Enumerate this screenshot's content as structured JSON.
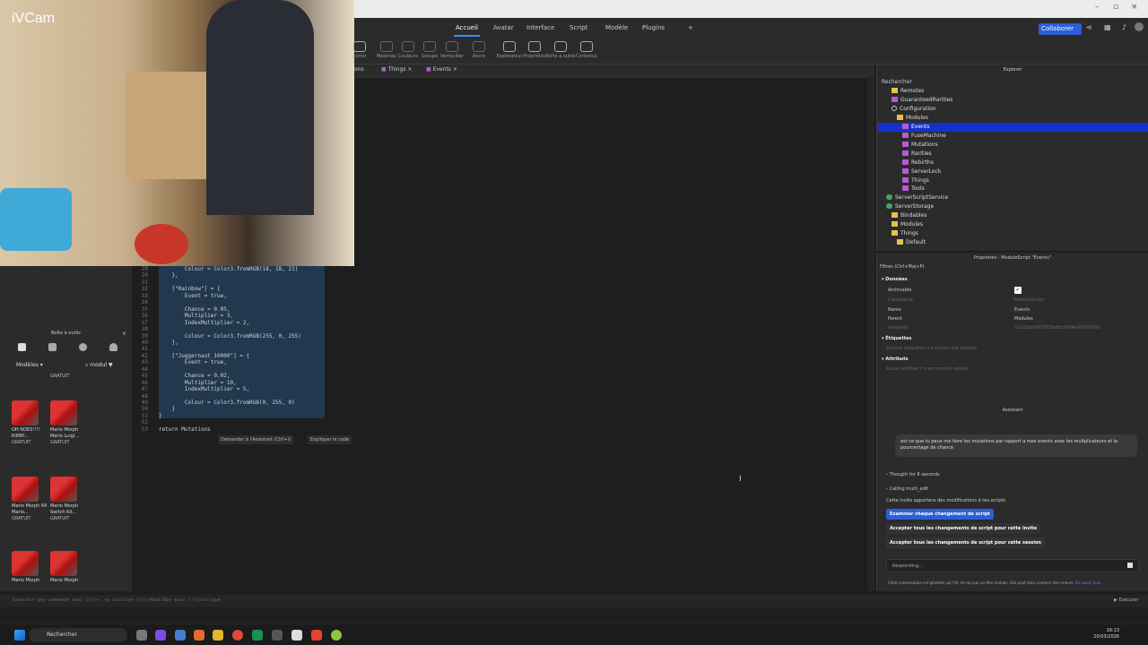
{
  "webcam": {
    "label": "iVCam"
  },
  "ribbon": {
    "tabs": [
      "Accueil",
      "Avatar",
      "Interface",
      "Script",
      "Modèle",
      "Plugins",
      "+"
    ],
    "active_tab": "Accueil",
    "collaborate": "Collaborer",
    "tools": [
      "porter",
      "Matériau",
      "Couleurs",
      "Groupe",
      "Verrouiller",
      "Ancre",
      "Explorateur",
      "Propriétés",
      "Boîte à outils",
      "Contenus"
    ]
  },
  "doc_tabs": [
    "ons",
    "Things",
    "Events"
  ],
  "toolbox": {
    "title": "Boîte à outils",
    "filter": "Modèles",
    "search": "modul",
    "assets": [
      {
        "name": "GRATUIT",
        "price": ""
      },
      {
        "name": "OH NOES!!!! KIRBY...",
        "price": "GRATUIT"
      },
      {
        "name": "Mario Morph Mario Luigi...",
        "price": "GRATUIT"
      },
      {
        "name": "Mario Morph 64 Mario...",
        "price": "GRATUIT"
      },
      {
        "name": "Mario Morph Switch Kit...",
        "price": "GRATUIT"
      },
      {
        "name": "Mario Morph",
        "price": ""
      },
      {
        "name": "Mario Morph",
        "price": ""
      }
    ]
  },
  "code": {
    "line_numbers": [
      "29",
      "30",
      "31",
      "32",
      "33",
      "34",
      "35",
      "36",
      "37",
      "38",
      "39",
      "40",
      "41",
      "42",
      "43",
      "44",
      "45",
      "46",
      "47",
      "48",
      "49",
      "50",
      "51",
      "52",
      "53"
    ],
    "lines": [
      "        Colour = Color3.fromRGB(18, 18, 21)",
      "    },",
      "",
      "    [\"Rainbow\"] = {",
      "        Event = true,",
      "",
      "        Chance = 0.05,",
      "        Multiplier = 3,",
      "        IndexMultiplier = 2,",
      "",
      "        Colour = Color3.fromRGB(255, 0, 255)",
      "    },",
      "",
      "    [\"Juggernaut 10000\"] = {",
      "        Event = true,",
      "",
      "        Chance = 0.02,",
      "        Multiplier = 10,",
      "        IndexMultiplier = 5,",
      "",
      "        Colour = Color3.fromRGB(0, 255, 0)",
      "    }",
      "}",
      "",
      "return Mutations"
    ],
    "ask_assistant": "Demander à l'Assistant (Ctrl+I)",
    "explain_code": "Expliquer le code"
  },
  "command_bar": {
    "placeholder": "Exécuter une commande avec Ctrl+; ou utiliser Ctrl+Haut/Bas pour l'historique",
    "run": "Exécuter"
  },
  "explorer": {
    "title": "Explorer",
    "search": "Rechercher",
    "tree": [
      {
        "label": "Remotes",
        "type": "folder",
        "indent": 1
      },
      {
        "label": "GuaranteedRarities",
        "type": "module",
        "indent": 1
      },
      {
        "label": "Configuration",
        "type": "gear",
        "indent": 1
      },
      {
        "label": "Modules",
        "type": "folder",
        "indent": 2
      },
      {
        "label": "Events",
        "type": "module",
        "indent": 3,
        "selected": true
      },
      {
        "label": "FuseMachine",
        "type": "module",
        "indent": 3
      },
      {
        "label": "Mutations",
        "type": "module",
        "indent": 3
      },
      {
        "label": "Rarities",
        "type": "module",
        "indent": 3
      },
      {
        "label": "Rebirths",
        "type": "module",
        "indent": 3
      },
      {
        "label": "ServerLock",
        "type": "module",
        "indent": 3
      },
      {
        "label": "Things",
        "type": "module",
        "indent": 3
      },
      {
        "label": "Tools",
        "type": "module",
        "indent": 3
      },
      {
        "label": "ServerScriptService",
        "type": "service",
        "indent": 0
      },
      {
        "label": "ServerStorage",
        "type": "service",
        "indent": 0
      },
      {
        "label": "Bindables",
        "type": "folder",
        "indent": 1
      },
      {
        "label": "Modules",
        "type": "folder",
        "indent": 1
      },
      {
        "label": "Things",
        "type": "folder",
        "indent": 1
      },
      {
        "label": "Default",
        "type": "folder",
        "indent": 2
      }
    ]
  },
  "properties": {
    "title": "Propriétés - ModuleScript \"Events\"",
    "filter": "Filtres (Ctrl+Maj+P)",
    "section_data": "Données",
    "archivable": "Archivable",
    "classname": "ClassName",
    "classname_value": "ModuleScript",
    "name_label": "Name",
    "name_value": "Events",
    "parent_label": "Parent",
    "parent_value": "Modules",
    "uniqueid_label": "UniqueId",
    "uniqueid_value": "01a1bbfe9f7853bdfbc86f4e00000000",
    "section_tags": "Étiquettes",
    "tags_empty": "Aucune étiquette n'a encore été ajoutée",
    "section_attrs": "Attributs",
    "attrs_empty": "Aucun attribut n'a encore été ajouté"
  },
  "assistant": {
    "title": "Assistant",
    "user_message": "est ce que tu peux me faire les mutations par rapport a mes events avec les multplicateurs et le pourcentage de chance",
    "thought": "Thought for 8 seconds",
    "calling": "Calling multi_edit",
    "info": "Cette invite apportera des modifications à tes scripts",
    "btn_review": "Examiner chaque changement de script",
    "btn_accept_prompt": "Accepter tous les changements de script pour cette invite",
    "btn_accept_session": "Accepter tous les changements de script pour cette session",
    "input": "Responding...",
    "disclaimer": "Cette conversation est générée par l'IA, et non par un être humain. Elle peut donc contenir des erreurs.",
    "learn_more": "En savoir plus"
  },
  "taskbar": {
    "search": "Rechercher",
    "time": "16:13",
    "date": "20/03/2026"
  },
  "colors": {
    "accent": "#2a5fd6",
    "selection": "#1432c8"
  }
}
